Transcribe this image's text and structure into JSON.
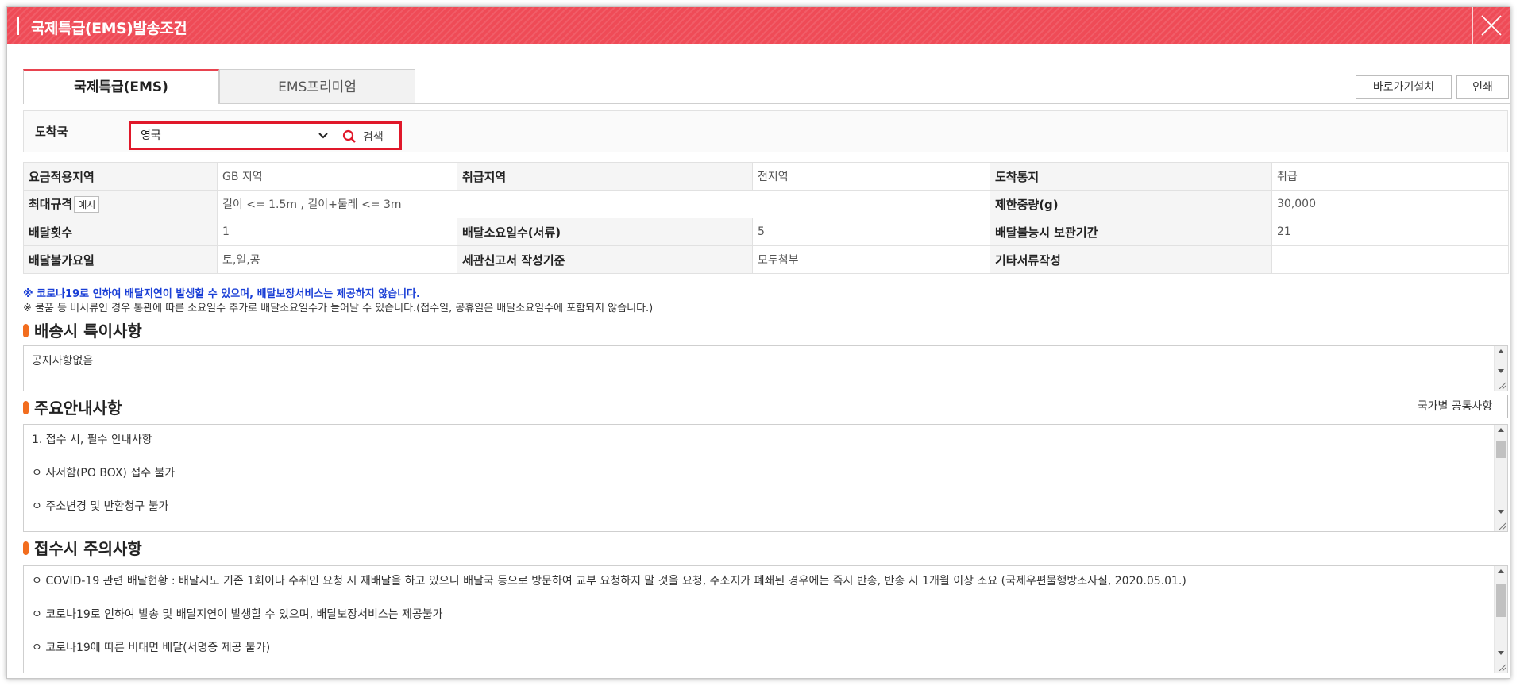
{
  "window": {
    "title": "국제특급(EMS)발송조건"
  },
  "tabs": [
    {
      "label": "국제특급(EMS)",
      "active": true
    },
    {
      "label": "EMS프리미엄",
      "active": false
    }
  ],
  "toolbar": {
    "shortcut_label": "바로가기설치",
    "print_label": "인쇄"
  },
  "destination": {
    "label": "도착국",
    "selected": "영국",
    "search_label": "검색"
  },
  "info_table": {
    "rows": [
      [
        {
          "h": "요금적용지역"
        },
        {
          "v": "GB 지역"
        },
        {
          "h": "취급지역"
        },
        {
          "v": "전지역"
        },
        {
          "h": "도착통지"
        },
        {
          "v": "취급"
        }
      ],
      [
        {
          "h": "최대규격"
        },
        {
          "v": "길이 <= 1.5m , 길이+둘레 <= 3m"
        },
        {
          "h": "제한중량(g)"
        },
        {
          "v": "30,000"
        }
      ],
      [
        {
          "h": "배달횟수"
        },
        {
          "v": "1"
        },
        {
          "h": "배달소요일수(서류)"
        },
        {
          "v": "5"
        },
        {
          "h": "배달불능시 보관기간"
        },
        {
          "v": "21"
        }
      ],
      [
        {
          "h": "배달불가요일"
        },
        {
          "v": "토,일,공"
        },
        {
          "h": "세관신고서 작성기준"
        },
        {
          "v": "모두첨부"
        },
        {
          "h": "기타서류작성"
        },
        {
          "v": ""
        }
      ]
    ],
    "example_label": "예시"
  },
  "notices": {
    "highlight": "※ 코로나19로 인하여 배달지연이 발생할 수 있으며, 배달보장서비스는 제공하지 않습니다.",
    "normal": "※ 물품 등 비서류인 경우 통관에 따른 소요일수 추가로 배달소요일수가 늘어날 수 있습니다.(접수일, 공휴일은 배달소요일수에 포함되지 않습니다.)"
  },
  "sections": {
    "special": {
      "title": "배송시 특이사항",
      "lines": [
        "공지사항없음"
      ]
    },
    "main_info": {
      "title": "주요안내사항",
      "button_label": "국가별 공통사항",
      "lines": [
        "1. 접수 시, 필수 안내사항",
        "ㅇ 사서함(PO BOX) 접수 불가",
        "ㅇ 주소변경 및 반환청구 불가"
      ]
    },
    "caution": {
      "title": "접수시 주의사항",
      "lines": [
        "ㅇ COVID-19 관련 배달현황 : 배달시도 기존 1회이나 수취인 요청 시 재배달을 하고 있으니 배달국 등으로 방문하여 교부 요청하지 말 것을 요청, 주소지가 폐쇄된 경우에는 즉시 반송, 반송 시 1개월 이상 소요 (국제우편물행방조사실, 2020.05.01.)",
        "ㅇ 코로나19로 인하여 발송 및 배달지연이 발생할 수 있으며, 배달보장서비스는 제공불가",
        "ㅇ 코로나19에 따른 비대면 배달(서명증 제공 불가)"
      ]
    }
  },
  "colors": {
    "title_bar": "#ef4b57",
    "active_tab_top": "#e8434f",
    "highlight_box": "#e0182a",
    "notice_blue": "#1a3fd6",
    "section_mark": "#f26d1e"
  }
}
